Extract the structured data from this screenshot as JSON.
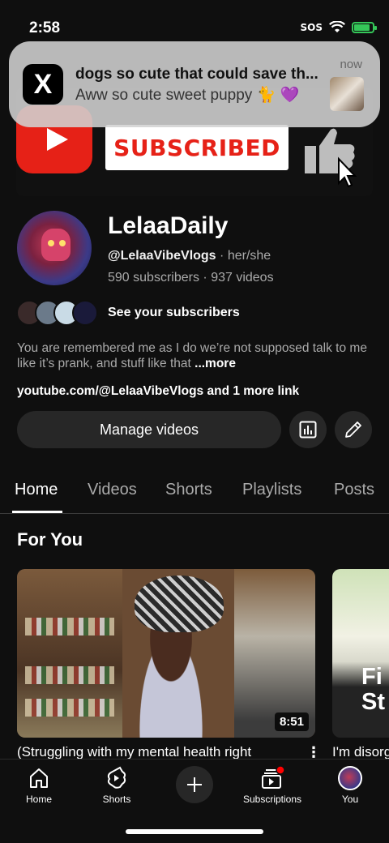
{
  "status_bar": {
    "time": "2:58",
    "sos": "SOS"
  },
  "notification": {
    "app_icon": "X",
    "title": "dogs so cute that could save th...",
    "body": "Aww so cute sweet puppy 🐈 💜",
    "time": "now"
  },
  "banner": {
    "subscribed_text": "SUBSCRIBED"
  },
  "channel": {
    "name": "LelaaDaily",
    "handle": "@LelaaVibeVlogs",
    "pronouns": "her/she",
    "subscribers": "590 subscribers",
    "videos": "937 videos",
    "see_subscribers": "See your subscribers",
    "description": "You are remembered me as I do we’re not supposed talk to me like it’s prank, and stuff like that ",
    "description_more": "...more",
    "link": "youtube.com/@LelaaVibeVlogs",
    "link_more": " and 1 more link",
    "manage_videos": "Manage videos"
  },
  "tabs": [
    {
      "label": "Home",
      "active": true
    },
    {
      "label": "Videos",
      "active": false
    },
    {
      "label": "Shorts",
      "active": false
    },
    {
      "label": "Playlists",
      "active": false
    },
    {
      "label": "Posts",
      "active": false
    }
  ],
  "section": {
    "title": "For You"
  },
  "videos": [
    {
      "title": "(Struggling with my mental health right",
      "duration": "8:51"
    },
    {
      "title": "I'm disorganized",
      "thumb_text": "Fi St"
    }
  ],
  "bottom_nav": {
    "home": "Home",
    "shorts": "Shorts",
    "subscriptions": "Subscriptions",
    "you": "You"
  },
  "colors": {
    "accent": "#ff0000",
    "background": "#0f0f0f",
    "chip": "#272727"
  }
}
